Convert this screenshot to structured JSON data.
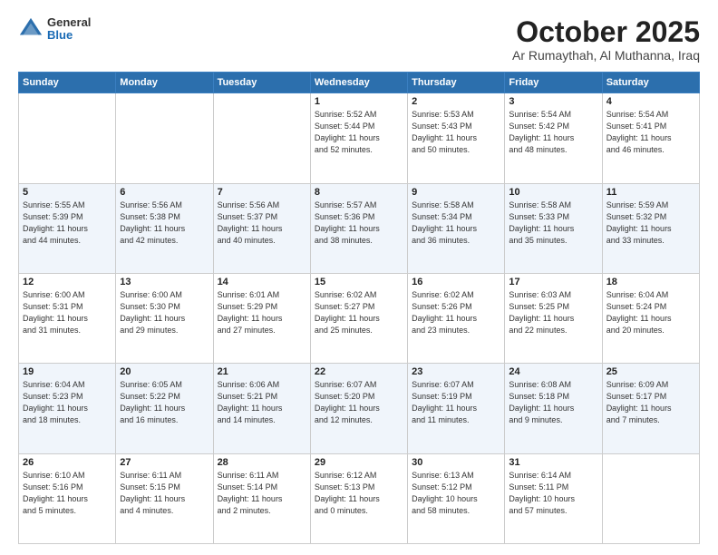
{
  "logo": {
    "general": "General",
    "blue": "Blue"
  },
  "header": {
    "title": "October 2025",
    "subtitle": "Ar Rumaythah, Al Muthanna, Iraq"
  },
  "weekdays": [
    "Sunday",
    "Monday",
    "Tuesday",
    "Wednesday",
    "Thursday",
    "Friday",
    "Saturday"
  ],
  "weeks": [
    [
      {
        "day": "",
        "info": ""
      },
      {
        "day": "",
        "info": ""
      },
      {
        "day": "",
        "info": ""
      },
      {
        "day": "1",
        "info": "Sunrise: 5:52 AM\nSunset: 5:44 PM\nDaylight: 11 hours\nand 52 minutes."
      },
      {
        "day": "2",
        "info": "Sunrise: 5:53 AM\nSunset: 5:43 PM\nDaylight: 11 hours\nand 50 minutes."
      },
      {
        "day": "3",
        "info": "Sunrise: 5:54 AM\nSunset: 5:42 PM\nDaylight: 11 hours\nand 48 minutes."
      },
      {
        "day": "4",
        "info": "Sunrise: 5:54 AM\nSunset: 5:41 PM\nDaylight: 11 hours\nand 46 minutes."
      }
    ],
    [
      {
        "day": "5",
        "info": "Sunrise: 5:55 AM\nSunset: 5:39 PM\nDaylight: 11 hours\nand 44 minutes."
      },
      {
        "day": "6",
        "info": "Sunrise: 5:56 AM\nSunset: 5:38 PM\nDaylight: 11 hours\nand 42 minutes."
      },
      {
        "day": "7",
        "info": "Sunrise: 5:56 AM\nSunset: 5:37 PM\nDaylight: 11 hours\nand 40 minutes."
      },
      {
        "day": "8",
        "info": "Sunrise: 5:57 AM\nSunset: 5:36 PM\nDaylight: 11 hours\nand 38 minutes."
      },
      {
        "day": "9",
        "info": "Sunrise: 5:58 AM\nSunset: 5:34 PM\nDaylight: 11 hours\nand 36 minutes."
      },
      {
        "day": "10",
        "info": "Sunrise: 5:58 AM\nSunset: 5:33 PM\nDaylight: 11 hours\nand 35 minutes."
      },
      {
        "day": "11",
        "info": "Sunrise: 5:59 AM\nSunset: 5:32 PM\nDaylight: 11 hours\nand 33 minutes."
      }
    ],
    [
      {
        "day": "12",
        "info": "Sunrise: 6:00 AM\nSunset: 5:31 PM\nDaylight: 11 hours\nand 31 minutes."
      },
      {
        "day": "13",
        "info": "Sunrise: 6:00 AM\nSunset: 5:30 PM\nDaylight: 11 hours\nand 29 minutes."
      },
      {
        "day": "14",
        "info": "Sunrise: 6:01 AM\nSunset: 5:29 PM\nDaylight: 11 hours\nand 27 minutes."
      },
      {
        "day": "15",
        "info": "Sunrise: 6:02 AM\nSunset: 5:27 PM\nDaylight: 11 hours\nand 25 minutes."
      },
      {
        "day": "16",
        "info": "Sunrise: 6:02 AM\nSunset: 5:26 PM\nDaylight: 11 hours\nand 23 minutes."
      },
      {
        "day": "17",
        "info": "Sunrise: 6:03 AM\nSunset: 5:25 PM\nDaylight: 11 hours\nand 22 minutes."
      },
      {
        "day": "18",
        "info": "Sunrise: 6:04 AM\nSunset: 5:24 PM\nDaylight: 11 hours\nand 20 minutes."
      }
    ],
    [
      {
        "day": "19",
        "info": "Sunrise: 6:04 AM\nSunset: 5:23 PM\nDaylight: 11 hours\nand 18 minutes."
      },
      {
        "day": "20",
        "info": "Sunrise: 6:05 AM\nSunset: 5:22 PM\nDaylight: 11 hours\nand 16 minutes."
      },
      {
        "day": "21",
        "info": "Sunrise: 6:06 AM\nSunset: 5:21 PM\nDaylight: 11 hours\nand 14 minutes."
      },
      {
        "day": "22",
        "info": "Sunrise: 6:07 AM\nSunset: 5:20 PM\nDaylight: 11 hours\nand 12 minutes."
      },
      {
        "day": "23",
        "info": "Sunrise: 6:07 AM\nSunset: 5:19 PM\nDaylight: 11 hours\nand 11 minutes."
      },
      {
        "day": "24",
        "info": "Sunrise: 6:08 AM\nSunset: 5:18 PM\nDaylight: 11 hours\nand 9 minutes."
      },
      {
        "day": "25",
        "info": "Sunrise: 6:09 AM\nSunset: 5:17 PM\nDaylight: 11 hours\nand 7 minutes."
      }
    ],
    [
      {
        "day": "26",
        "info": "Sunrise: 6:10 AM\nSunset: 5:16 PM\nDaylight: 11 hours\nand 5 minutes."
      },
      {
        "day": "27",
        "info": "Sunrise: 6:11 AM\nSunset: 5:15 PM\nDaylight: 11 hours\nand 4 minutes."
      },
      {
        "day": "28",
        "info": "Sunrise: 6:11 AM\nSunset: 5:14 PM\nDaylight: 11 hours\nand 2 minutes."
      },
      {
        "day": "29",
        "info": "Sunrise: 6:12 AM\nSunset: 5:13 PM\nDaylight: 11 hours\nand 0 minutes."
      },
      {
        "day": "30",
        "info": "Sunrise: 6:13 AM\nSunset: 5:12 PM\nDaylight: 10 hours\nand 58 minutes."
      },
      {
        "day": "31",
        "info": "Sunrise: 6:14 AM\nSunset: 5:11 PM\nDaylight: 10 hours\nand 57 minutes."
      },
      {
        "day": "",
        "info": ""
      }
    ]
  ]
}
